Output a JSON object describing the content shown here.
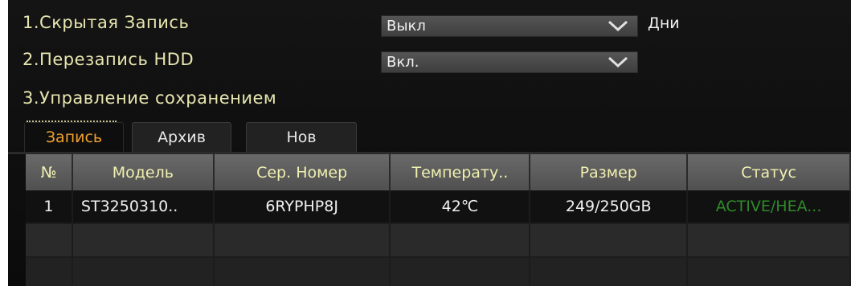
{
  "settings": {
    "hidden_record": {
      "label": "1.Скрытая Запись",
      "value": "Выкл",
      "suffix": "Дни"
    },
    "hdd_overwrite": {
      "label": "2.Перезапись HDD",
      "value": "Вкл."
    },
    "storage_mgmt": {
      "label": "3.Управление сохранением"
    }
  },
  "tabs": [
    {
      "label": "Запись",
      "active": true
    },
    {
      "label": "Архив",
      "active": false
    },
    {
      "label": "Нов",
      "active": false
    }
  ],
  "table": {
    "headers": [
      "№",
      "Модель",
      "Сер. Номер",
      "Температу..",
      "Размер",
      "Статус"
    ],
    "rows": [
      {
        "num": "1",
        "model": "ST3250310..",
        "serial": "6RYPHP8J",
        "temp": "42℃",
        "size": "249/250GB",
        "status": "ACTIVE/HEA..."
      }
    ]
  },
  "colors": {
    "label_text": "#e8e6b0",
    "active_tab": "#f0a030",
    "status_active": "#2f8a2a"
  },
  "icons": {
    "dropdown": "chevron-down-icon"
  }
}
